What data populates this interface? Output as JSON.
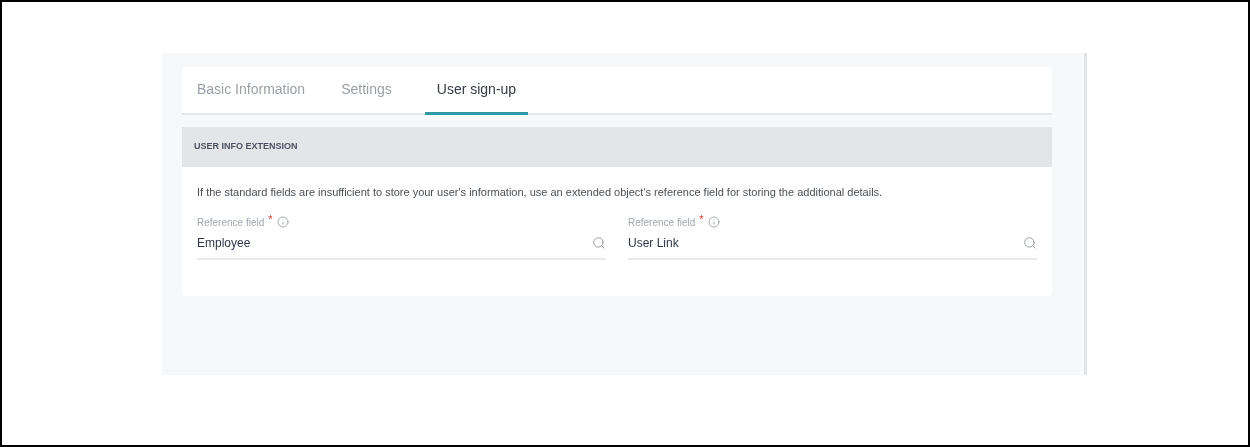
{
  "tabs": [
    {
      "label": "Basic Information",
      "selected": false
    },
    {
      "label": "Settings",
      "selected": false
    },
    {
      "label": "User sign-up",
      "selected": true
    }
  ],
  "section": {
    "title": "USER INFO EXTENSION",
    "description": "If the standard fields are insufficient to store your user's information, use an extended object's reference field for storing the additional details.",
    "fields": [
      {
        "label": "Reference field",
        "required_mark": "*",
        "value": "Employee"
      },
      {
        "label": "Reference field",
        "required_mark": "*",
        "value": "User Link"
      }
    ]
  }
}
